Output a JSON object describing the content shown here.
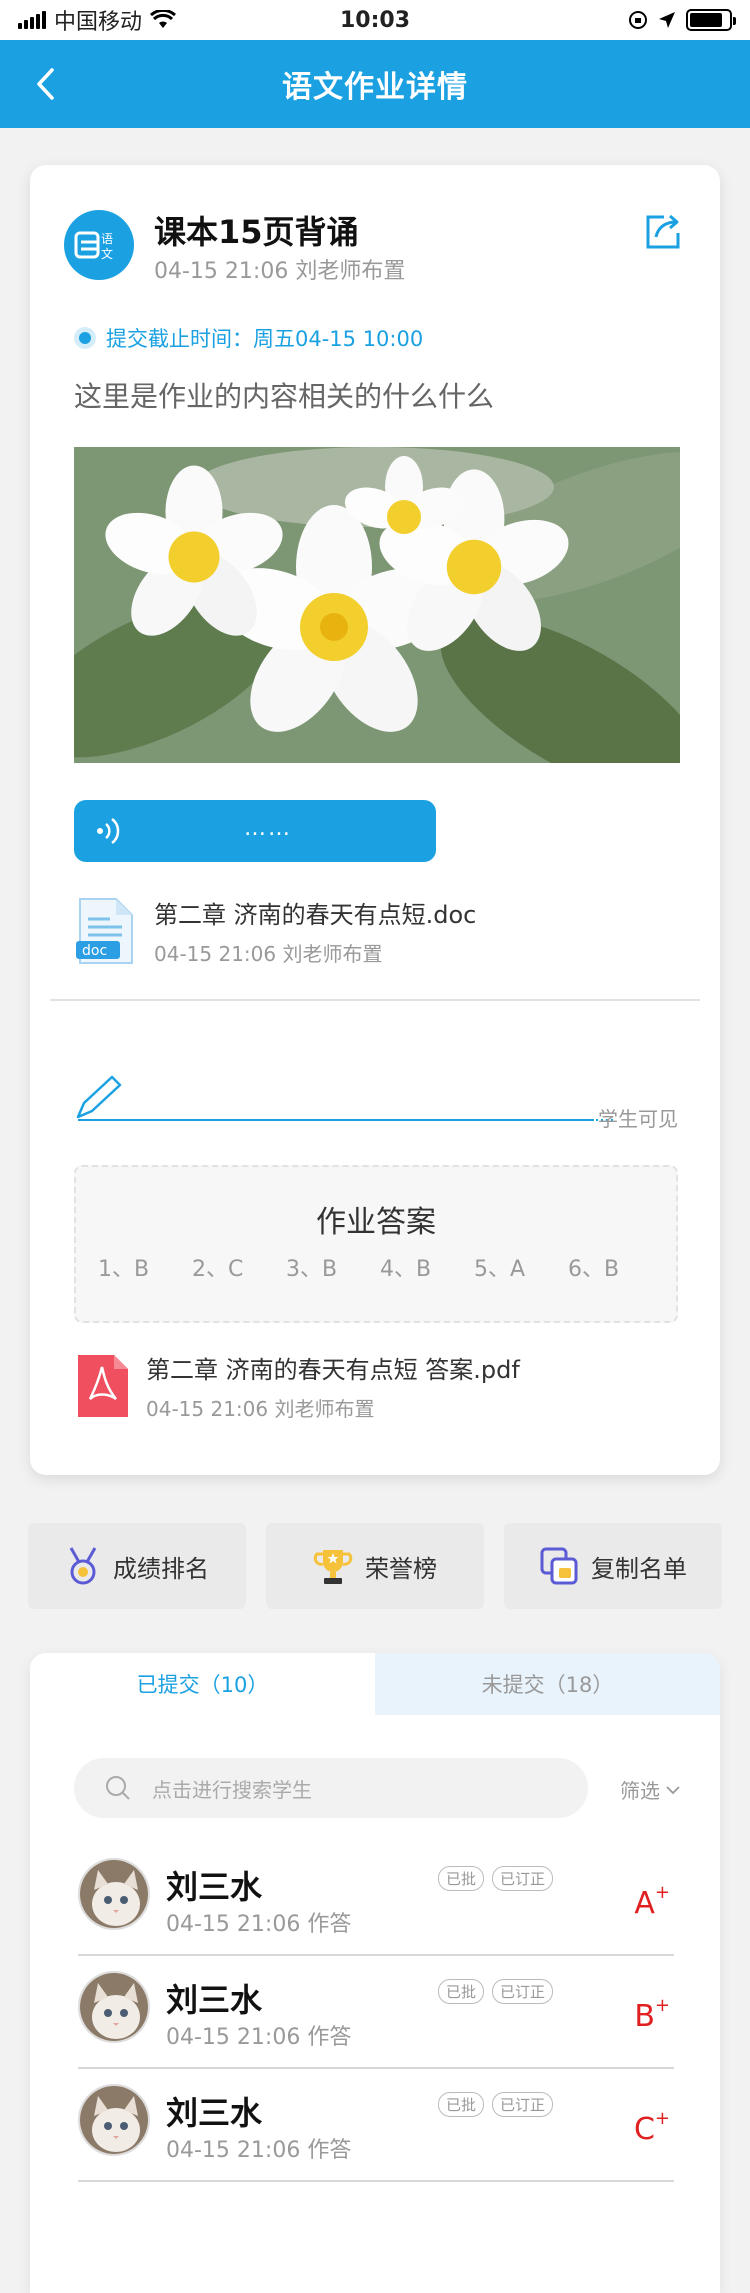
{
  "status_bar": {
    "carrier": "中国移动",
    "time": "10:03"
  },
  "nav": {
    "title": "语文作业详情"
  },
  "assignment": {
    "subject_icon_text": "语文",
    "title": "课本15页背诵",
    "meta": "04-15 21:06 刘老师布置",
    "deadline": "提交截止时间：周五04-15 10:00",
    "content": "这里是作业的内容相关的什么什么",
    "audio_label": "……",
    "attachment": {
      "name": "第二章 济南的春天有点短.doc",
      "meta": "04-15 21:06 刘老师布置",
      "type_label": "doc"
    },
    "visibility": "学生可见",
    "answer": {
      "title": "作业答案",
      "items": [
        "1、B",
        "2、C",
        "3、B",
        "4、B",
        "5、A",
        "6、B"
      ]
    },
    "answer_attachment": {
      "name": "第二章 济南的春天有点短 答案.pdf",
      "meta": "04-15 21:06 刘老师布置"
    }
  },
  "actions": [
    {
      "label": "成绩排名",
      "icon": "medal-icon"
    },
    {
      "label": "荣誉榜",
      "icon": "trophy-icon"
    },
    {
      "label": "复制名单",
      "icon": "copy-icon"
    }
  ],
  "tabs": {
    "submitted": "已提交（10）",
    "not_submitted": "未提交（18）"
  },
  "search": {
    "placeholder": "点击进行搜索学生",
    "filter": "筛选"
  },
  "students": [
    {
      "name": "刘三水",
      "meta": "04-15 21:06 作答",
      "badge1": "已批",
      "badge2": "已订正",
      "grade": "A",
      "grade_sup": "+"
    },
    {
      "name": "刘三水",
      "meta": "04-15 21:06 作答",
      "badge1": "已批",
      "badge2": "已订正",
      "grade": "B",
      "grade_sup": "+"
    },
    {
      "name": "刘三水",
      "meta": "04-15 21:06 作答",
      "badge1": "已批",
      "badge2": "已订正",
      "grade": "C",
      "grade_sup": "+"
    }
  ],
  "colors": {
    "primary": "#1ba1e2",
    "grade_red": "#e02020"
  }
}
